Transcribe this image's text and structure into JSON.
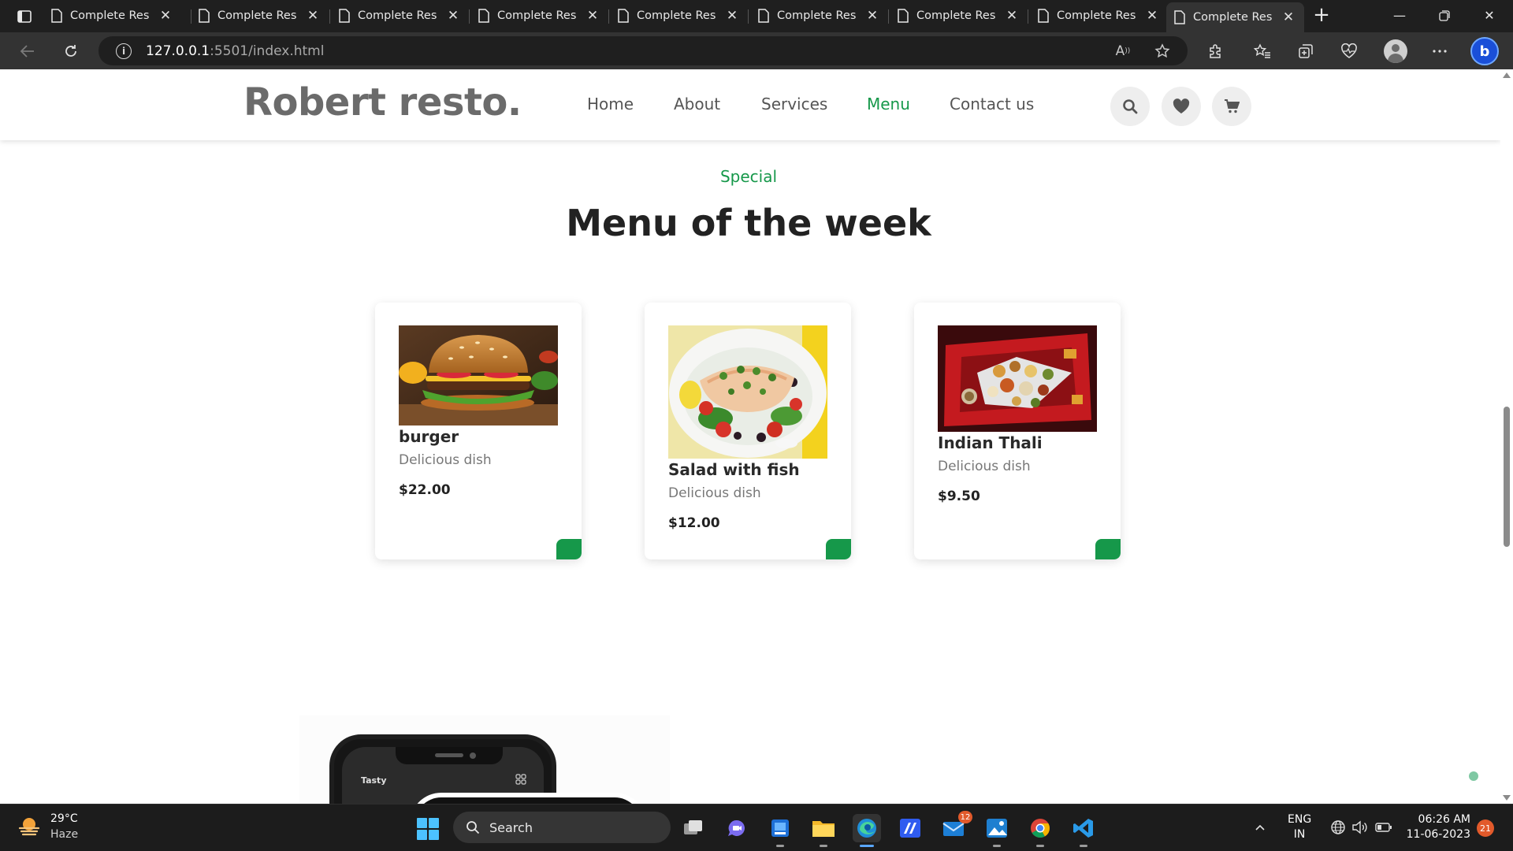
{
  "browser": {
    "tabs": [
      {
        "title": "Complete Responsive",
        "active": false
      },
      {
        "title": "Complete Responsive",
        "active": false
      },
      {
        "title": "Complete Responsive",
        "active": false
      },
      {
        "title": "Complete Responsive",
        "active": false
      },
      {
        "title": "Complete Responsive",
        "active": false
      },
      {
        "title": "Complete Responsive",
        "active": false
      },
      {
        "title": "Complete Responsive",
        "active": false
      },
      {
        "title": "Complete Responsive",
        "active": false
      },
      {
        "title": "Complete Responsive",
        "active": true
      }
    ],
    "url_host": "127.0.0.1",
    "url_rest": ":5501/index.html"
  },
  "site": {
    "logo": "Robert resto.",
    "nav": [
      {
        "label": "Home",
        "active": false
      },
      {
        "label": "About",
        "active": false
      },
      {
        "label": "Services",
        "active": false
      },
      {
        "label": "Menu",
        "active": true
      },
      {
        "label": "Contact us",
        "active": false
      }
    ],
    "header_icons": [
      "search-icon",
      "heart-icon",
      "cart-icon"
    ],
    "accent_color": "#16984a"
  },
  "menu_section": {
    "subtitle": "Special",
    "title": "Menu of the week",
    "items": [
      {
        "name": "burger",
        "description": "Delicious dish",
        "price": "$22.00",
        "image": "burger-photo"
      },
      {
        "name": "Salad with fish",
        "description": "Delicious dish",
        "price": "$12.00",
        "image": "salad-photo"
      },
      {
        "name": "Indian Thali",
        "description": "Delicious dish",
        "price": "$9.50",
        "image": "thali-photo"
      }
    ]
  },
  "phone_preview": {
    "app_label": "Tasty"
  },
  "taskbar": {
    "weather_temp": "29°C",
    "weather_cond": "Haze",
    "search_label": "Search",
    "mail_badge": "12",
    "lang_line1": "ENG",
    "lang_line2": "IN",
    "time": "06:26 AM",
    "date": "11-06-2023",
    "notifications": "21"
  }
}
